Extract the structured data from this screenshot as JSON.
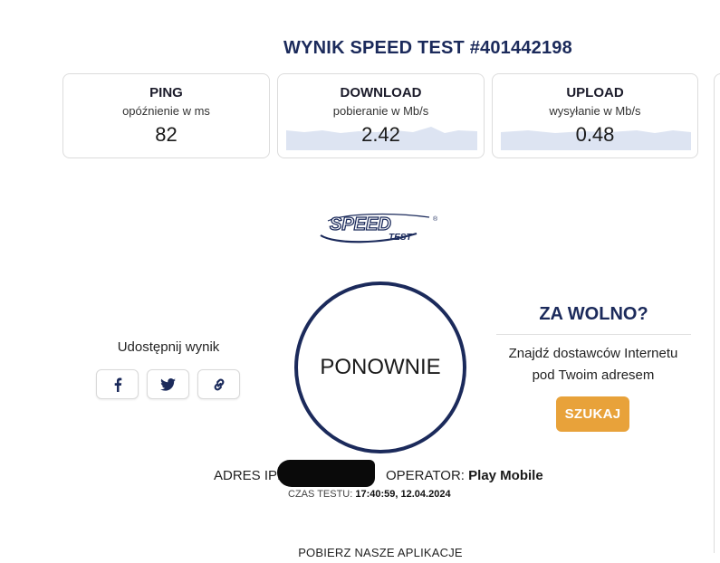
{
  "header": {
    "title": "WYNIK SPEED TEST #401442198"
  },
  "results": {
    "ping": {
      "label": "PING",
      "sublabel": "opóźnienie w ms",
      "value": "82"
    },
    "download": {
      "label": "DOWNLOAD",
      "sublabel": "pobieranie w Mb/s",
      "value": "2.42"
    },
    "upload": {
      "label": "UPLOAD",
      "sublabel": "wysyłanie w Mb/s",
      "value": "0.48"
    }
  },
  "logo": {
    "text_main": "SPEED",
    "text_sub": "TEST",
    "mark": "®"
  },
  "share": {
    "label": "Udostępnij wynik",
    "buttons": [
      {
        "icon": "facebook-icon"
      },
      {
        "icon": "twitter-icon"
      },
      {
        "icon": "link-icon"
      }
    ]
  },
  "retest": {
    "label": "PONOWNIE"
  },
  "promo": {
    "title": "ZA WOLNO?",
    "text_line1": "Znajdź dostawców Internetu",
    "text_line2": "pod Twoim adresem",
    "button_label": "SZUKAJ"
  },
  "info": {
    "ip_label": "ADRES IP:",
    "operator_label": "OPERATOR:",
    "operator_value": "Play Mobile",
    "time_label": "CZAS TESTU:",
    "time_value": "17:40:59, 12.04.2024"
  },
  "footer": {
    "apps_label": "POBIERZ NASZE APLIKACJE"
  },
  "colors": {
    "brand": "#1b2a5b",
    "accent": "#e8a23a",
    "spark_fill": "#dde4f2"
  }
}
